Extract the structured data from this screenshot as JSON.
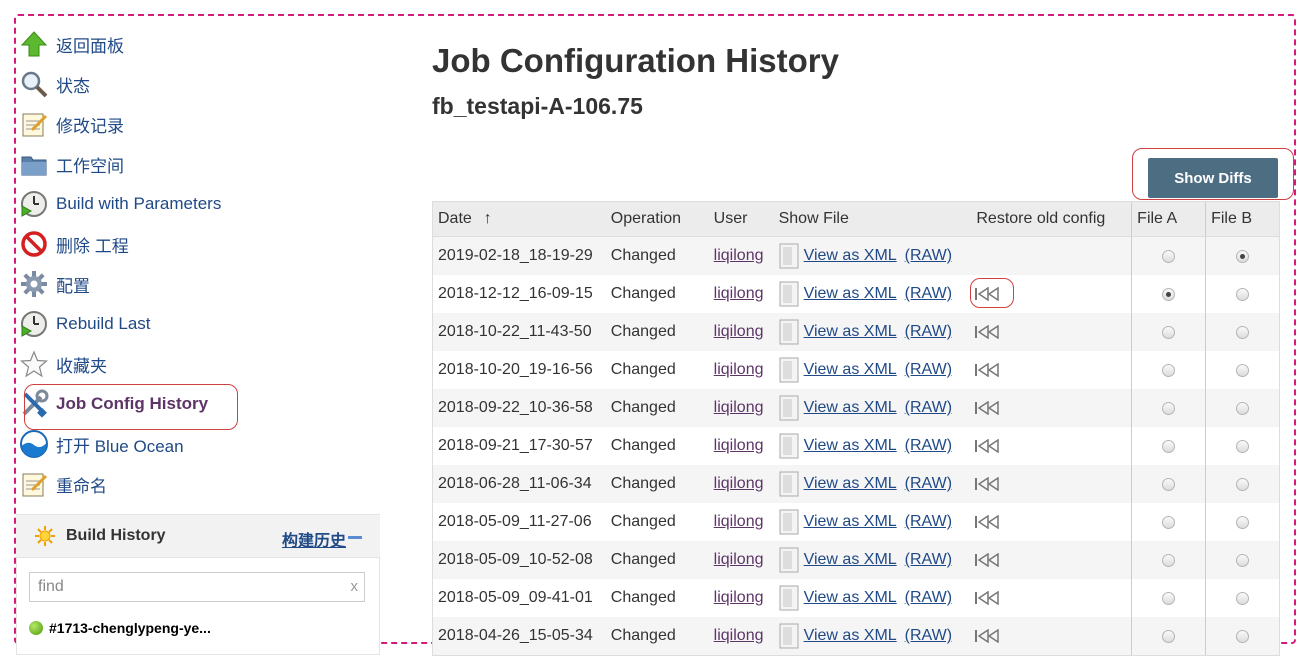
{
  "sidebar": {
    "tasks": [
      {
        "label": "返回面板",
        "icon": "up-arrow-icon"
      },
      {
        "label": "状态",
        "icon": "magnifier-icon"
      },
      {
        "label": "修改记录",
        "icon": "notepad-icon"
      },
      {
        "label": "工作空间",
        "icon": "folder-icon"
      },
      {
        "label": "Build with Parameters",
        "icon": "clock-play-icon"
      },
      {
        "label": "删除 工程",
        "icon": "no-entry-icon"
      },
      {
        "label": "配置",
        "icon": "gear-icon"
      },
      {
        "label": "Rebuild Last",
        "icon": "clock-play-icon"
      },
      {
        "label": "收藏夹",
        "icon": "star-icon"
      },
      {
        "label": "Job Config History",
        "icon": "tools-icon"
      },
      {
        "label": "打开 Blue Ocean",
        "icon": "blue-ocean-icon"
      },
      {
        "label": "重命名",
        "icon": "notepad-icon"
      }
    ],
    "build_history": {
      "title": "Build History",
      "link": "构建历史",
      "search_placeholder": "find",
      "clear": "x",
      "first_build": "#1713-chenglypeng-ye..."
    }
  },
  "main": {
    "title": "Job Configuration History",
    "job_name": "fb_testapi-A-106.75",
    "show_diffs_label": "Show Diffs",
    "columns": {
      "date": "Date",
      "sort_arrow": "↑",
      "operation": "Operation",
      "user": "User",
      "show_file": "Show File",
      "restore": "Restore old config",
      "file_a": "File A",
      "file_b": "File B"
    },
    "view_xml_label": "View as XML",
    "raw_label": "(RAW)",
    "rows": [
      {
        "date": "2019-02-18_18-19-29",
        "operation": "Changed",
        "user": "liqilong",
        "restore": false,
        "file_a": false,
        "file_b": true
      },
      {
        "date": "2018-12-12_16-09-15",
        "operation": "Changed",
        "user": "liqilong",
        "restore": true,
        "file_a": true,
        "file_b": false
      },
      {
        "date": "2018-10-22_11-43-50",
        "operation": "Changed",
        "user": "liqilong",
        "restore": true,
        "file_a": false,
        "file_b": false
      },
      {
        "date": "2018-10-20_19-16-56",
        "operation": "Changed",
        "user": "liqilong",
        "restore": true,
        "file_a": false,
        "file_b": false
      },
      {
        "date": "2018-09-22_10-36-58",
        "operation": "Changed",
        "user": "liqilong",
        "restore": true,
        "file_a": false,
        "file_b": false
      },
      {
        "date": "2018-09-21_17-30-57",
        "operation": "Changed",
        "user": "liqilong",
        "restore": true,
        "file_a": false,
        "file_b": false
      },
      {
        "date": "2018-06-28_11-06-34",
        "operation": "Changed",
        "user": "liqilong",
        "restore": true,
        "file_a": false,
        "file_b": false
      },
      {
        "date": "2018-05-09_11-27-06",
        "operation": "Changed",
        "user": "liqilong",
        "restore": true,
        "file_a": false,
        "file_b": false
      },
      {
        "date": "2018-05-09_10-52-08",
        "operation": "Changed",
        "user": "liqilong",
        "restore": true,
        "file_a": false,
        "file_b": false
      },
      {
        "date": "2018-05-09_09-41-01",
        "operation": "Changed",
        "user": "liqilong",
        "restore": true,
        "file_a": false,
        "file_b": false
      },
      {
        "date": "2018-04-26_15-05-34",
        "operation": "Changed",
        "user": "liqilong",
        "restore": true,
        "file_a": false,
        "file_b": false
      }
    ]
  },
  "colors": {
    "link": "#204a87",
    "visited_link": "#5c3566",
    "button": "#4d6d83",
    "highlight": "#d04040",
    "frame": "#d61a7a"
  }
}
